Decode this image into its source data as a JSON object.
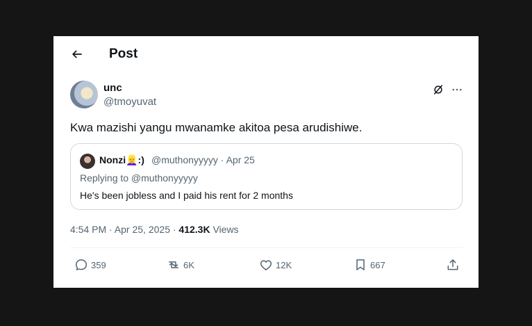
{
  "header": {
    "title": "Post"
  },
  "tweet": {
    "display_name": "unc",
    "handle": "@tmoyuvat",
    "text": "Kwa mazishi yangu mwanamke akitoa pesa arudishiwe.",
    "time": "4:54 PM · Apr 25, 2025 · ",
    "views": "412.3K",
    "views_label": " Views"
  },
  "quote": {
    "display_name": "Nonzi👱‍♀️:)",
    "handle_date": "@muthonyyyyy · Apr 25",
    "replying_to": "Replying to @muthonyyyyy",
    "text": "He's been jobless and I paid his rent for 2 months"
  },
  "actions": {
    "replies": "359",
    "reposts": "6K",
    "likes": "12K",
    "bookmarks": "667"
  },
  "icons": [
    "back-arrow-icon",
    "grok-icon",
    "more-icon",
    "reply-icon",
    "repost-icon",
    "like-icon",
    "bookmark-icon",
    "share-icon"
  ],
  "colors": {
    "background": "#151515",
    "card": "#ffffff",
    "text": "#0f1419",
    "muted": "#536471",
    "border": "#cfd9de"
  }
}
